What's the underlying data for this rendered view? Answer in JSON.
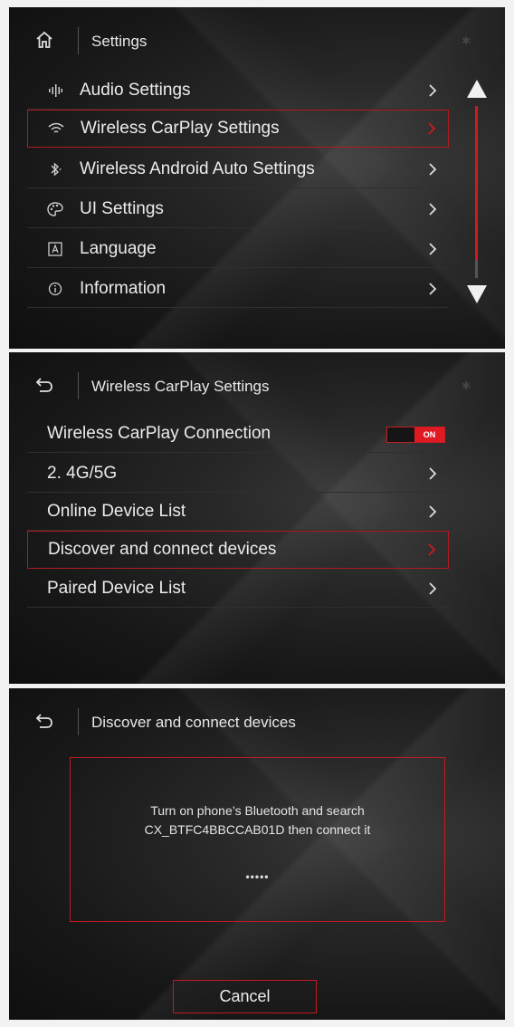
{
  "colors": {
    "accent": "#d41820",
    "text": "#ececec",
    "background": "#161616"
  },
  "screen1": {
    "title": "Settings",
    "title_icon": "home-icon",
    "items": [
      {
        "label": "Audio Settings",
        "icon": "equalizer-icon"
      },
      {
        "label": "Wireless CarPlay Settings",
        "icon": "wifi-icon",
        "selected": true
      },
      {
        "label": "Wireless Android Auto Settings",
        "icon": "bluetooth-icon"
      },
      {
        "label": "UI Settings",
        "icon": "palette-icon"
      },
      {
        "label": "Language",
        "icon": "language-icon"
      },
      {
        "label": "Information",
        "icon": "info-icon"
      }
    ],
    "scroll": {
      "up_icon": "triangle-up-icon",
      "down_icon": "triangle-down-icon"
    }
  },
  "screen2": {
    "title": "Wireless CarPlay Settings",
    "title_icon": "back-icon",
    "connection": {
      "label": "Wireless CarPlay Connection",
      "toggle_state": "ON"
    },
    "items": [
      {
        "label": "2. 4G/5G"
      },
      {
        "label": "Online Device List"
      },
      {
        "label": "Discover and connect devices",
        "selected": true
      },
      {
        "label": "Paired Device List"
      }
    ]
  },
  "screen3": {
    "title": "Discover and connect devices",
    "title_icon": "back-icon",
    "dialog": {
      "line1": "Turn on phone’s Bluetooth and search",
      "line2": "CX_BTFC4BBCCAB01D then connect it",
      "progress": "•••••"
    },
    "cancel_label": "Cancel"
  }
}
